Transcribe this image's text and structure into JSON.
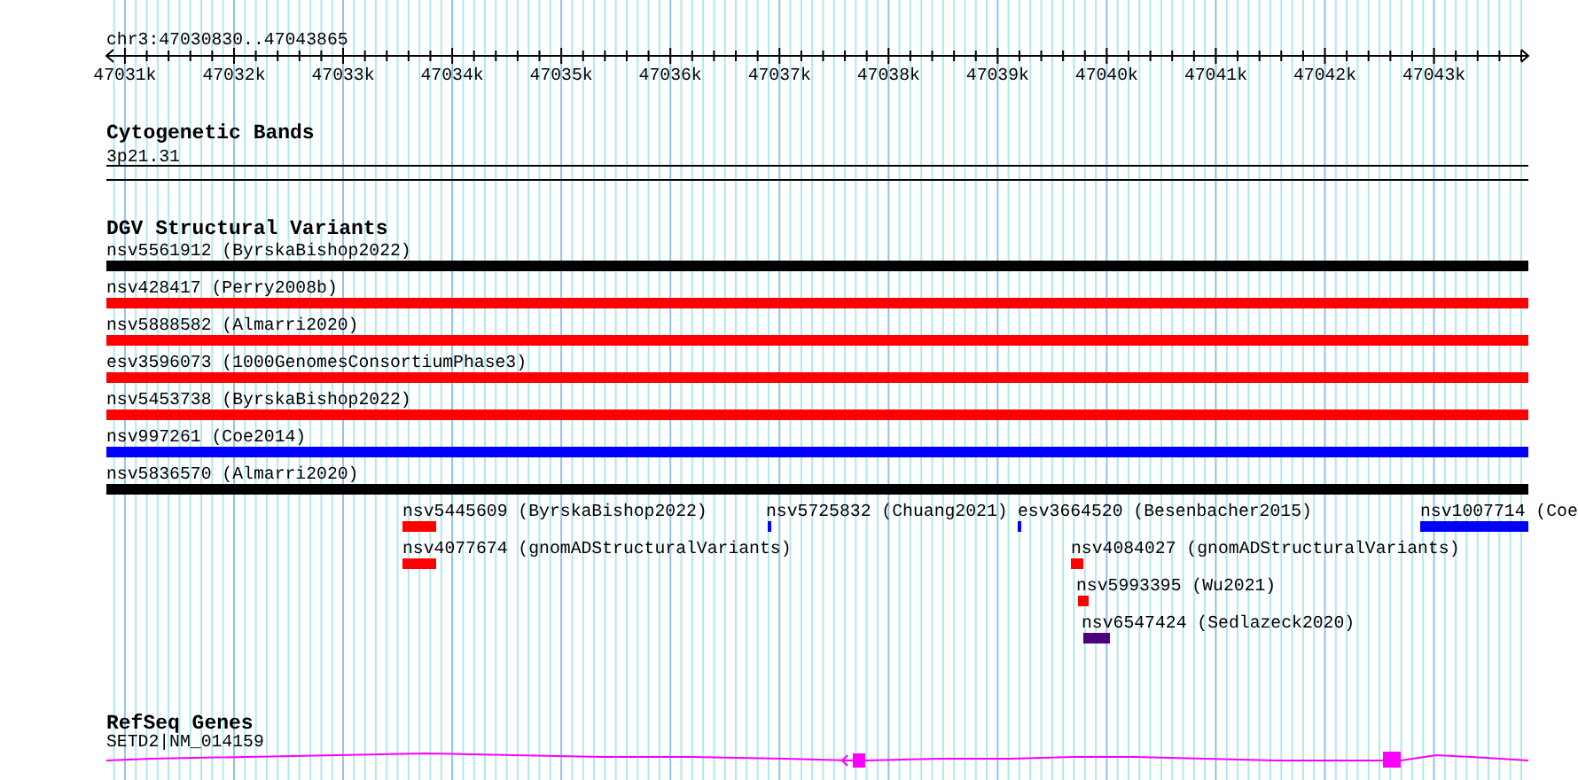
{
  "location": "chr3:47030830..47043865",
  "ruler": {
    "ticks": [
      "47031k",
      "47032k",
      "47033k",
      "47034k",
      "47035k",
      "47036k",
      "47037k",
      "47038k",
      "47039k",
      "47040k",
      "47041k",
      "47042k",
      "47043k"
    ]
  },
  "tracks": [
    {
      "kind": "cytoband",
      "title": "Cytogenetic Bands",
      "features": [
        {
          "label": "3p21.31"
        }
      ]
    },
    {
      "kind": "variants",
      "title": "DGV Structural Variants",
      "features": [
        {
          "label": "nsv5561912 (ByrskaBishop2022)",
          "color": "#000000"
        },
        {
          "label": "nsv428417 (Perry2008b)",
          "color": "#ff0000"
        },
        {
          "label": "nsv5888582 (Almarri2020)",
          "color": "#ff0000"
        },
        {
          "label": "esv3596073 (1000GenomesConsortiumPhase3)",
          "color": "#ff0000"
        },
        {
          "label": "nsv5453738 (ByrskaBishop2022)",
          "color": "#ff0000"
        },
        {
          "label": "nsv997261 (Coe2014)",
          "color": "#0000ff"
        },
        {
          "label": "nsv5836570 (Almarri2020)",
          "color": "#000000"
        },
        {
          "label": "nsv5445609 (ByrskaBishop2022)",
          "color": "#ff0000"
        },
        {
          "label": "nsv5725832 (Chuang2021)",
          "color": "#0000ff"
        },
        {
          "label": "esv3664520 (Besenbacher2015)",
          "color": "#0000ff"
        },
        {
          "label": "nsv1007714 (Coe",
          "color": "#0000ff"
        },
        {
          "label": "nsv4077674 (gnomADStructuralVariants)",
          "color": "#ff0000"
        },
        {
          "label": "nsv4084027 (gnomADStructuralVariants)",
          "color": "#ff0000"
        },
        {
          "label": "nsv5993395 (Wu2021)",
          "color": "#ff0000"
        },
        {
          "label": "nsv6547424 (Sedlazeck2020)",
          "color": "#4b0082"
        }
      ]
    },
    {
      "kind": "genes",
      "title": "RefSeq Genes",
      "features": [
        {
          "label": "SETD2|NM_014159"
        }
      ]
    }
  ]
}
